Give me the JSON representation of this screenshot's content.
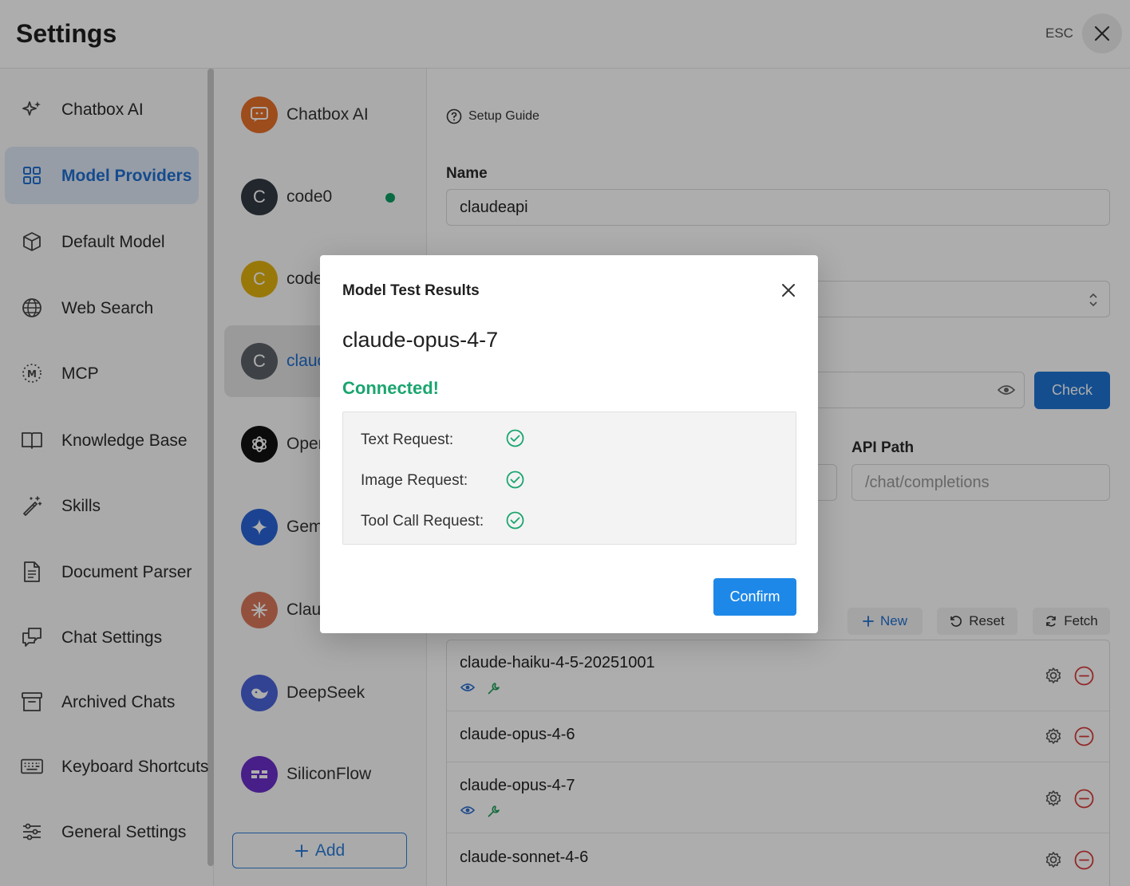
{
  "header": {
    "title": "Settings",
    "esc_label": "ESC"
  },
  "nav": {
    "items": [
      {
        "label": "Chatbox AI",
        "icon": "sparkles-icon"
      },
      {
        "label": "Model Providers",
        "icon": "grid-icon",
        "active": true
      },
      {
        "label": "Default Model",
        "icon": "cube-icon"
      },
      {
        "label": "Web Search",
        "icon": "globe-icon"
      },
      {
        "label": "MCP",
        "icon": "mcp-icon"
      },
      {
        "label": "Knowledge Base",
        "icon": "book-icon"
      },
      {
        "label": "Skills",
        "icon": "magic-wand-icon"
      },
      {
        "label": "Document Parser",
        "icon": "document-icon"
      },
      {
        "label": "Chat Settings",
        "icon": "chat-icon"
      },
      {
        "label": "Archived Chats",
        "icon": "archive-icon"
      },
      {
        "label": "Keyboard Shortcuts",
        "icon": "keyboard-icon"
      },
      {
        "label": "General Settings",
        "icon": "sliders-icon"
      }
    ]
  },
  "providers": {
    "items": [
      {
        "name": "Chatbox AI",
        "avatar": "",
        "color": "#e8702a"
      },
      {
        "name": "code0",
        "avatar": "C",
        "color": "#333a44",
        "online": true
      },
      {
        "name": "code",
        "avatar": "C",
        "color": "#e2b20f"
      },
      {
        "name": "clauc",
        "avatar": "C",
        "color": "#5c6068",
        "active": true
      },
      {
        "name": "Oper",
        "avatar": "",
        "color": "#111111"
      },
      {
        "name": "Gem",
        "avatar": "",
        "color": "#2a63d8"
      },
      {
        "name": "Clau",
        "avatar": "",
        "color": "#d9785a"
      },
      {
        "name": "DeepSeek",
        "avatar": "",
        "color": "#4a63d9"
      },
      {
        "name": "SiliconFlow",
        "avatar": "",
        "color": "#6b2fc9"
      }
    ],
    "add_label": "Add"
  },
  "main": {
    "setup_guide": "Setup Guide",
    "name_label": "Name",
    "name_value": "claudeapi",
    "check_label": "Check",
    "api_path_label": "API Path",
    "api_path_placeholder": "/chat/completions",
    "new_label": "New",
    "reset_label": "Reset",
    "fetch_label": "Fetch",
    "models": [
      {
        "name": "claude-haiku-4-5-20251001",
        "vision": true,
        "tools": true
      },
      {
        "name": "claude-opus-4-6",
        "vision": false,
        "tools": false
      },
      {
        "name": "claude-opus-4-7",
        "vision": true,
        "tools": true
      },
      {
        "name": "claude-sonnet-4-6",
        "vision": false,
        "tools": false
      }
    ]
  },
  "dialog": {
    "title": "Model Test Results",
    "model": "claude-opus-4-7",
    "status": "Connected!",
    "results": [
      {
        "label": "Text Request:",
        "ok": true
      },
      {
        "label": "Image Request:",
        "ok": true
      },
      {
        "label": "Tool Call Request:",
        "ok": true
      }
    ],
    "confirm_label": "Confirm"
  },
  "colors": {
    "accent": "#1e88e8",
    "success": "#1aa56f",
    "danger": "#d93a3a",
    "active_nav": "#1f6fd1"
  }
}
